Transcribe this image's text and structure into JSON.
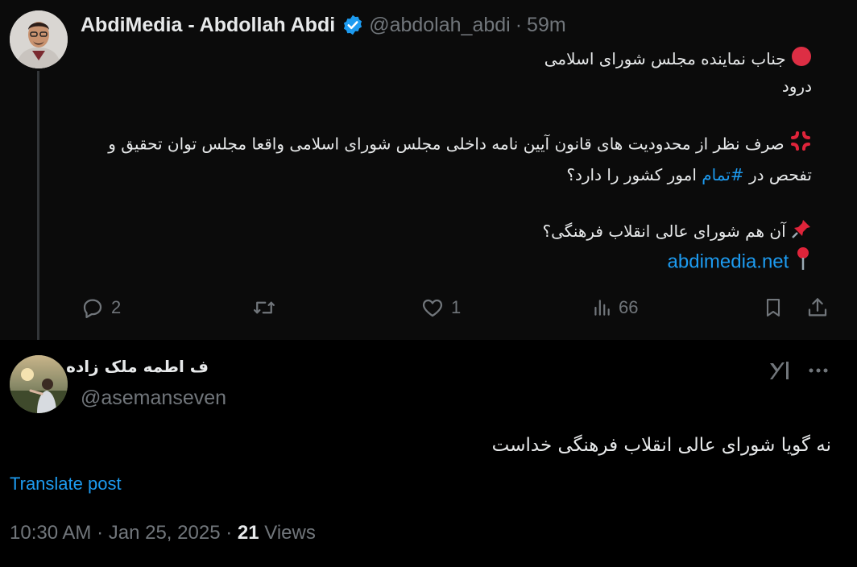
{
  "original_post": {
    "display_name": "AbdiMedia - Abdollah Abdi",
    "handle": "@abdolah_abdi",
    "separator": "·",
    "time_ago": "59m",
    "lines": [
      "جناب نماینده مجلس شورای اسلامی",
      "درود",
      "صرف نظر از محدودیت های قانون آیین نامه داخلی مجلس شورای اسلامی واقعا مجلس توان تحقیق و",
      "تفحص در",
      "#تمام",
      "امور کشور را دارد؟",
      "آن هم شورای عالی انقلاب فرهنگی؟",
      "abdimedia.net"
    ],
    "actions": {
      "replies": "2",
      "reposts": "",
      "likes": "1",
      "views": "66"
    }
  },
  "reply_post": {
    "display_name": "ف اطمه ملک زاده",
    "handle": "@asemanseven",
    "text": "نه گویا شورای عالی انقلاب فرهنگی خداست",
    "translate_label": "Translate post",
    "time": "10:30 AM",
    "date": "Jan 25, 2025",
    "views_count": "21",
    "views_label": "Views"
  },
  "icons": [
    "verified-badge-icon",
    "red-circle-emoji",
    "anger-symbol-emoji",
    "pushpin-emoji",
    "round-pushpin-emoji",
    "reply-icon",
    "repost-icon",
    "like-icon",
    "views-icon",
    "bookmark-icon",
    "share-icon",
    "grok-icon",
    "more-icon"
  ],
  "colors": {
    "accent": "#1d9bf0",
    "muted": "#71767b",
    "text": "#e7e9ea",
    "background": "#000000"
  }
}
